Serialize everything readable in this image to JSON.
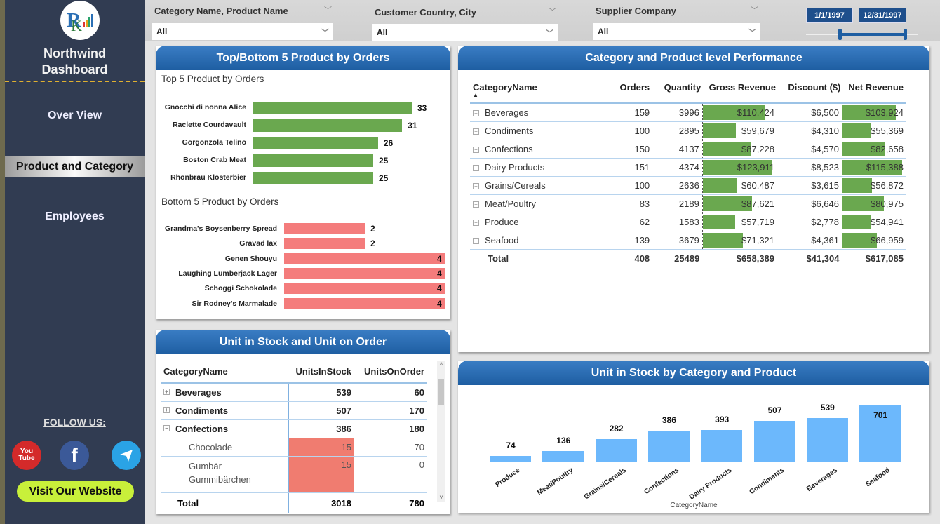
{
  "sidebar": {
    "brand_line1": "Northwind",
    "brand_line2": "Dashboard",
    "nav": [
      {
        "label": "Over View",
        "active": false
      },
      {
        "label": "Product and Category",
        "active": true
      },
      {
        "label": "Employees",
        "active": false
      }
    ],
    "follow_label": "FOLLOW US:",
    "social": [
      {
        "icon": "youtube-icon",
        "color": "#d42a2a"
      },
      {
        "icon": "facebook-icon",
        "color": "#3b5998"
      },
      {
        "icon": "telegram-icon",
        "color": "#2aa3e6"
      }
    ],
    "visit_label": "Visit Our Website"
  },
  "filters": {
    "category": {
      "label": "Category Name, Product Name",
      "value": "All"
    },
    "customer": {
      "label": "Customer Country, City",
      "value": "All"
    },
    "supplier": {
      "label": "Supplier Company",
      "value": "All"
    },
    "date_start": "1/1/1997",
    "date_end": "12/31/1997"
  },
  "topbottom": {
    "title": "Top/Bottom 5 Product by Orders",
    "top_title": "Top 5 Product by Orders",
    "bottom_title": "Bottom 5 Product by Orders",
    "top": [
      {
        "name": "Gnocchi di nonna Alice",
        "value": 33
      },
      {
        "name": "Raclette Courdavault",
        "value": 31
      },
      {
        "name": "Gorgonzola Telino",
        "value": 26
      },
      {
        "name": "Boston Crab Meat",
        "value": 25
      },
      {
        "name": "Rhönbräu Klosterbier",
        "value": 25
      }
    ],
    "bottom": [
      {
        "name": "Grandma's Boysenberry Spread",
        "value": 2
      },
      {
        "name": "Gravad lax",
        "value": 2
      },
      {
        "name": "Genen Shouyu",
        "value": 4
      },
      {
        "name": "Laughing Lumberjack Lager",
        "value": 4
      },
      {
        "name": "Schoggi Schokolade",
        "value": 4
      },
      {
        "name": "Sir Rodney's Marmalade",
        "value": 4
      }
    ],
    "top_color": "#6aa84f",
    "bottom_color": "#f47c7c"
  },
  "performance": {
    "title": "Category and Product level Performance",
    "columns": [
      "CategoryName",
      "Orders",
      "Quantity",
      "Gross Revenue",
      "Discount ($)",
      "Net Revenue"
    ],
    "rows": [
      {
        "cat": "Beverages",
        "orders": "159",
        "qty": "3996",
        "gross": "$110,424",
        "gross_v": 110424,
        "disc": "$6,500",
        "net": "$103,924",
        "net_v": 103924
      },
      {
        "cat": "Condiments",
        "orders": "100",
        "qty": "2895",
        "gross": "$59,679",
        "gross_v": 59679,
        "disc": "$4,310",
        "net": "$55,369",
        "net_v": 55369
      },
      {
        "cat": "Confections",
        "orders": "150",
        "qty": "4137",
        "gross": "$87,228",
        "gross_v": 87228,
        "disc": "$4,570",
        "net": "$82,658",
        "net_v": 82658
      },
      {
        "cat": "Dairy Products",
        "orders": "151",
        "qty": "4374",
        "gross": "$123,911",
        "gross_v": 123911,
        "disc": "$8,523",
        "net": "$115,388",
        "net_v": 115388
      },
      {
        "cat": "Grains/Cereals",
        "orders": "100",
        "qty": "2636",
        "gross": "$60,487",
        "gross_v": 60487,
        "disc": "$3,615",
        "net": "$56,872",
        "net_v": 56872
      },
      {
        "cat": "Meat/Poultry",
        "orders": "83",
        "qty": "2189",
        "gross": "$87,621",
        "gross_v": 87621,
        "disc": "$6,646",
        "net": "$80,975",
        "net_v": 80975
      },
      {
        "cat": "Produce",
        "orders": "62",
        "qty": "1583",
        "gross": "$57,719",
        "gross_v": 57719,
        "disc": "$2,778",
        "net": "$54,941",
        "net_v": 54941
      },
      {
        "cat": "Seafood",
        "orders": "139",
        "qty": "3679",
        "gross": "$71,321",
        "gross_v": 71321,
        "disc": "$4,361",
        "net": "$66,959",
        "net_v": 66959
      }
    ],
    "total": {
      "cat": "Total",
      "orders": "408",
      "qty": "25489",
      "gross": "$658,389",
      "disc": "$41,304",
      "net": "$617,085"
    }
  },
  "stock": {
    "title": "Unit in Stock and Unit on Order",
    "columns": [
      "CategoryName",
      "UnitsInStock",
      "UnitsOnOrder"
    ],
    "rows": [
      {
        "name": "Beverages",
        "level": 0,
        "expander": "+",
        "stock": "539",
        "order": "60"
      },
      {
        "name": "Condiments",
        "level": 0,
        "expander": "+",
        "stock": "507",
        "order": "170"
      },
      {
        "name": "Confections",
        "level": 0,
        "expander": "−",
        "stock": "386",
        "order": "180"
      },
      {
        "name": "Chocolade",
        "level": 1,
        "expander": "",
        "stock": "15",
        "order": "70",
        "highlight": true
      },
      {
        "name": "Gumbär Gummibärchen",
        "level": 1,
        "expander": "",
        "stock": "15",
        "order": "0",
        "highlight": true
      }
    ],
    "total": {
      "name": "Total",
      "stock": "3018",
      "order": "780"
    }
  },
  "chart_data": {
    "type": "bar",
    "title": "Unit in Stock by Category and Product",
    "xlabel": "CategoryName",
    "ylabel": "",
    "categories": [
      "Produce",
      "Meat/Poultry",
      "Grains/Cereals",
      "Confections",
      "Dairy Products",
      "Condiments",
      "Beverages",
      "Seafood"
    ],
    "values": [
      74,
      136,
      282,
      386,
      393,
      507,
      539,
      701
    ],
    "ylim": [
      0,
      701
    ],
    "grid": false,
    "color": "#6cb8fc"
  }
}
